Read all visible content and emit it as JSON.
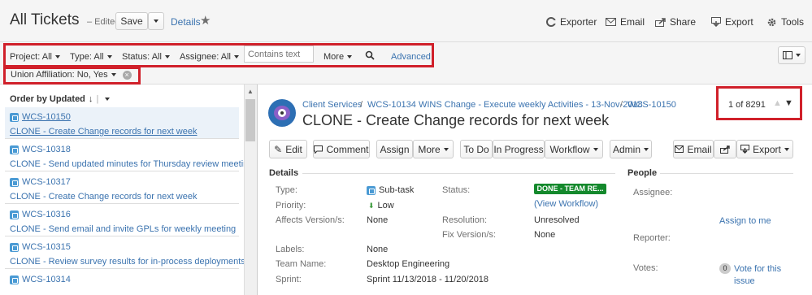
{
  "header": {
    "title": "All Tickets",
    "edited": "– Edited",
    "save_label": "Save",
    "details_label": "Details",
    "actions": [
      {
        "label": "Exporter",
        "icon": "exporter-icon"
      },
      {
        "label": "Email",
        "icon": "email-icon"
      },
      {
        "label": "Share",
        "icon": "share-icon"
      },
      {
        "label": "Export",
        "icon": "export-icon"
      },
      {
        "label": "Tools",
        "icon": "gear-icon"
      }
    ]
  },
  "filters": {
    "project": "Project: All",
    "type": "Type: All",
    "status": "Status: All",
    "assignee": "Assignee: All",
    "search_placeholder": "Contains text",
    "more": "More",
    "advanced": "Advanced",
    "union": "Union Affiliation: No, Yes"
  },
  "list": {
    "order_label": "Order by Updated",
    "items": [
      {
        "key": "WCS-10150",
        "summary": "CLONE - Create Change records for next week"
      },
      {
        "key": "WCS-10318",
        "summary": "CLONE - Send updated minutes for Thursday review meeting"
      },
      {
        "key": "WCS-10317",
        "summary": "CLONE - Create Change records for next week"
      },
      {
        "key": "WCS-10316",
        "summary": "CLONE - Send email and invite GPLs for weekly meeting"
      },
      {
        "key": "WCS-10315",
        "summary": "CLONE - Review survey results for in-process deployments"
      },
      {
        "key": "WCS-10314",
        "summary": ""
      }
    ]
  },
  "issue": {
    "crumb_project": "Client Services",
    "crumb_parent": "WCS-10134 WINS Change - Execute weekly Activities - 13-Nov-2018",
    "crumb_key": "WCS-10150",
    "title": "CLONE - Create Change records for next week",
    "pager": "1 of 8291",
    "buttons": {
      "edit": "Edit",
      "comment": "Comment",
      "assign": "Assign",
      "more": "More",
      "todo": "To Do",
      "inprogress": "In Progress",
      "workflow": "Workflow",
      "admin": "Admin",
      "email": "Email",
      "export": "Export"
    },
    "details_heading": "Details",
    "people_heading": "People",
    "fields": {
      "type_label": "Type:",
      "type_value": "Sub-task",
      "priority_label": "Priority:",
      "priority_value": "Low",
      "affects_label": "Affects Version/s:",
      "affects_value": "None",
      "labels_label": "Labels:",
      "labels_value": "None",
      "team_label": "Team Name:",
      "team_value": "Desktop Engineering",
      "sprint_label": "Sprint:",
      "sprint_value": "Sprint 11/13/2018 - 11/20/2018",
      "status_label": "Status:",
      "status_value": "DONE - TEAM RE...",
      "view_workflow": "(View Workflow)",
      "resolution_label": "Resolution:",
      "resolution_value": "Unresolved",
      "fix_label": "Fix Version/s:",
      "fix_value": "None"
    },
    "people": {
      "assignee_label": "Assignee:",
      "assign_to_me": "Assign to me",
      "reporter_label": "Reporter:",
      "votes_label": "Votes:",
      "votes_count": "0",
      "vote_text": "Vote for this issue"
    }
  },
  "colors": {
    "accent": "#3b73af",
    "highlight": "#d0202a",
    "status": "#14892c"
  }
}
